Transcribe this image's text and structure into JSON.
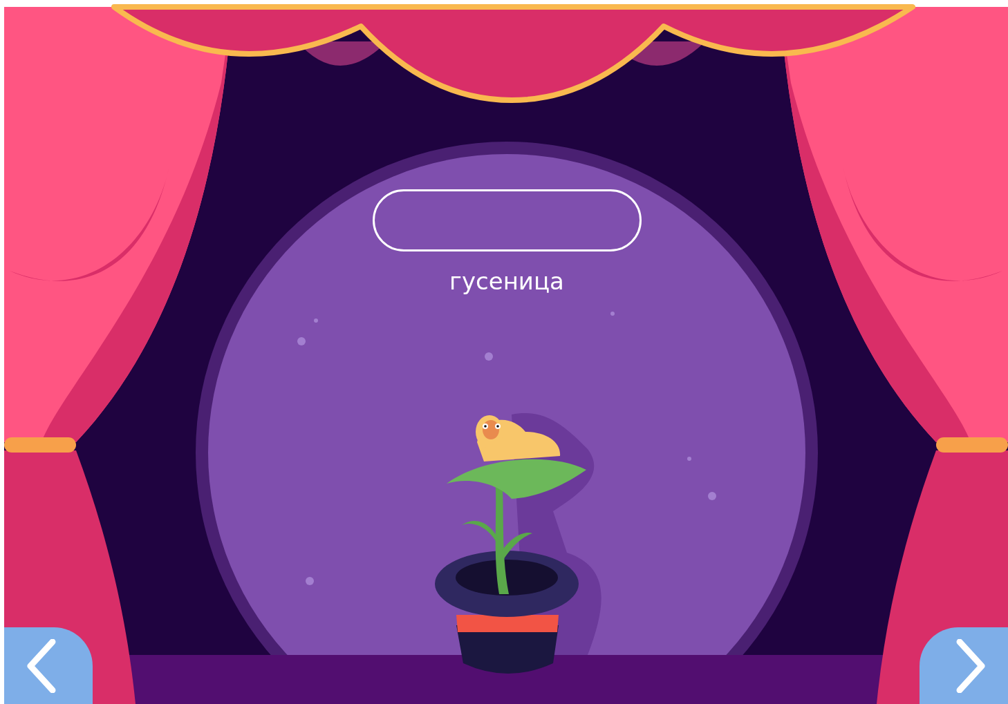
{
  "word": "гусеница",
  "nav_buttons": [
    {
      "kind": "prev"
    },
    {
      "kind": "next"
    }
  ]
}
